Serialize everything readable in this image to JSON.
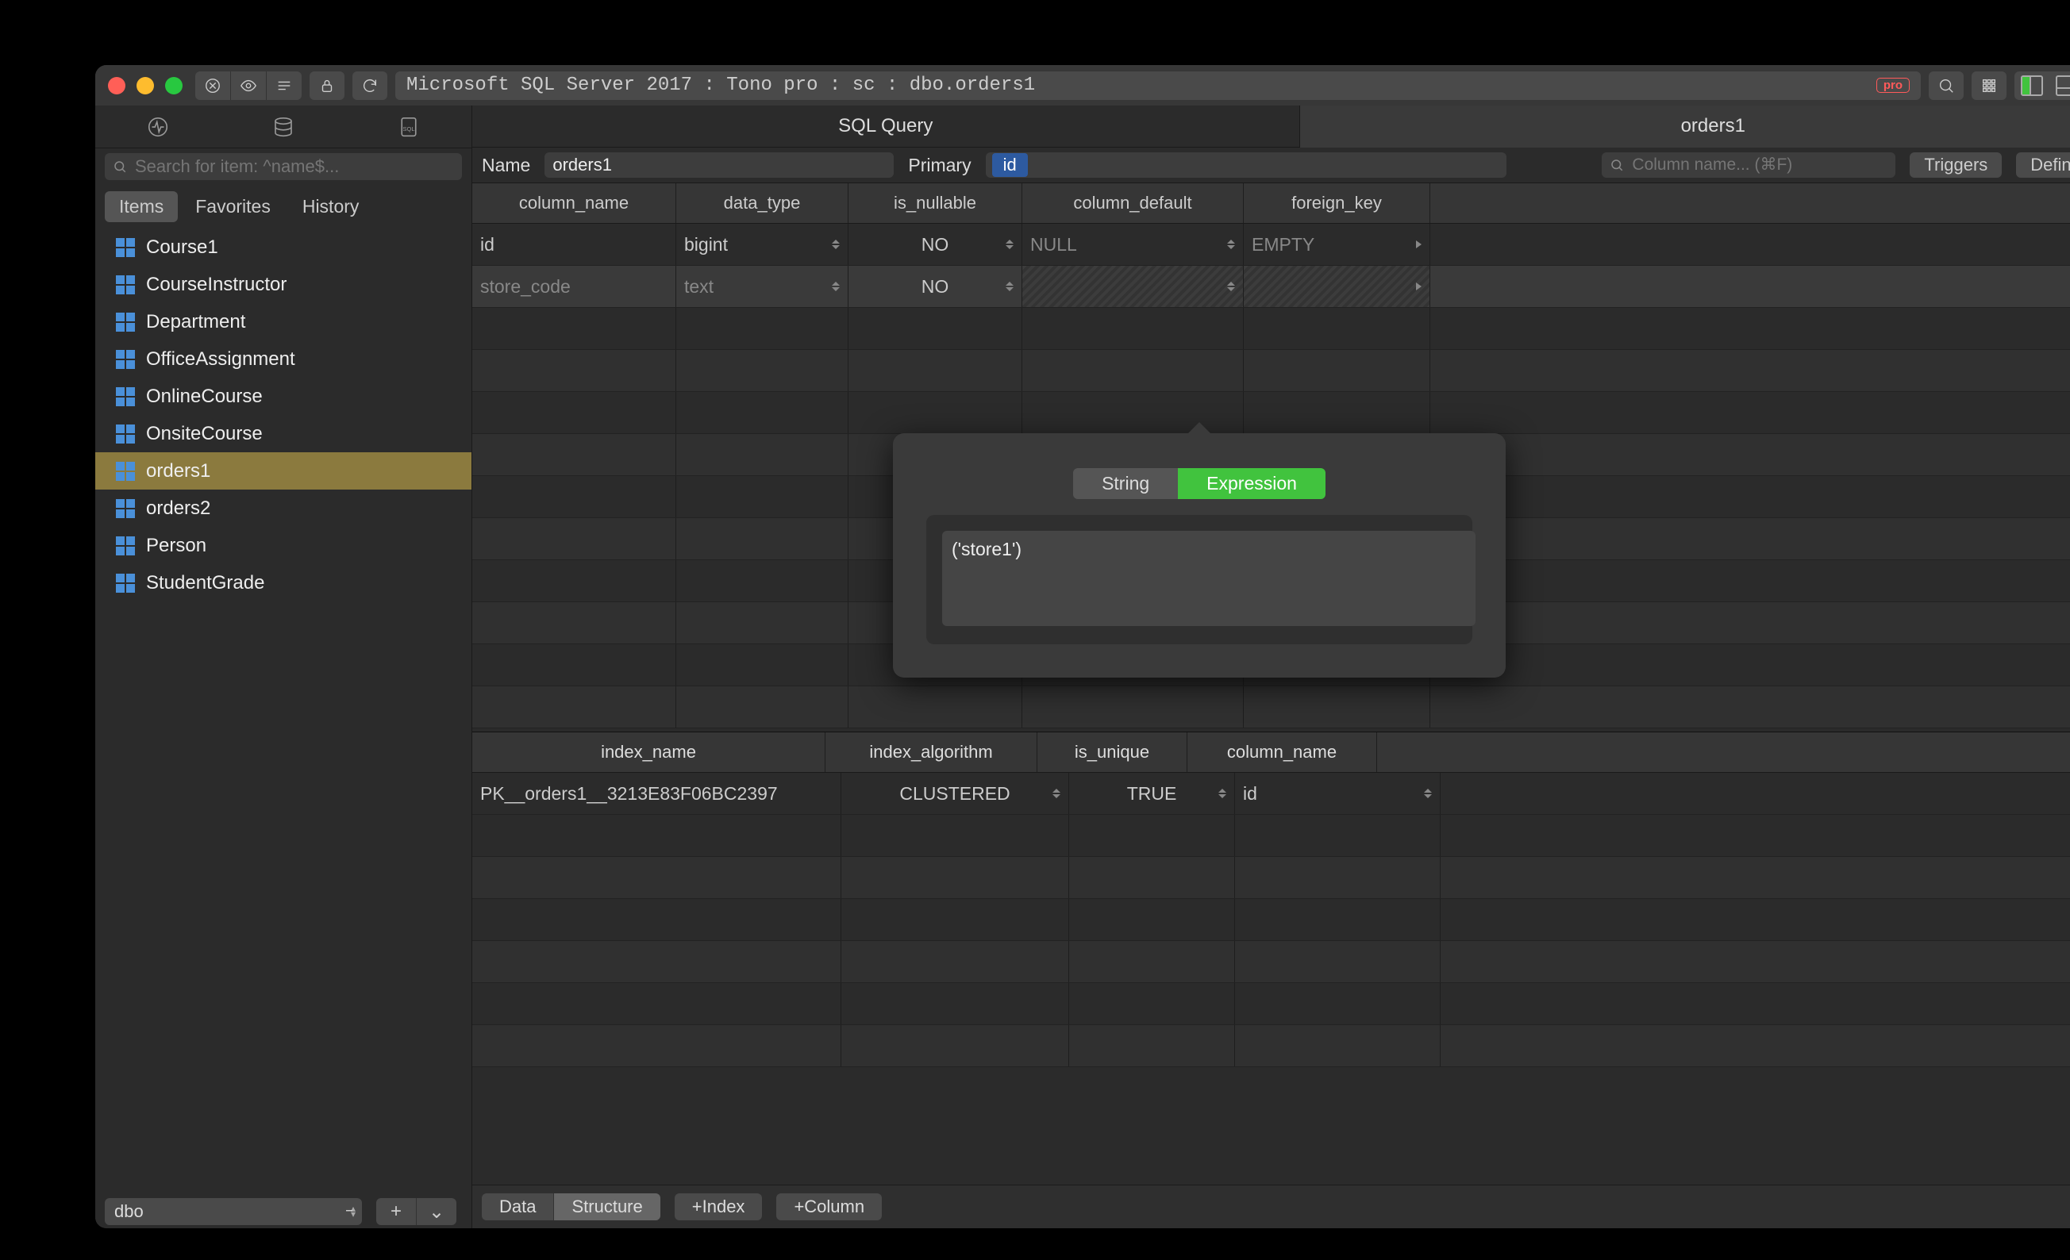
{
  "titlebar": {
    "address": "Microsoft SQL Server 2017 : Tono pro : sc : dbo.orders1",
    "pro_badge": "pro"
  },
  "sidebar": {
    "search_placeholder": "Search for item: ^name$...",
    "tabs": [
      "Items",
      "Favorites",
      "History"
    ],
    "active_tab": 0,
    "items": [
      "Course1",
      "CourseInstructor",
      "Department",
      "OfficeAssignment",
      "OnlineCourse",
      "OnsiteCourse",
      "orders1",
      "orders2",
      "Person",
      "StudentGrade"
    ],
    "selected": "orders1",
    "schema": "dbo"
  },
  "main": {
    "tabs": [
      "SQL Query",
      "orders1"
    ],
    "active_tab": 1,
    "name_label": "Name",
    "name_value": "orders1",
    "primary_label": "Primary",
    "primary_token": "id",
    "col_search_placeholder": "Column name... (⌘F)",
    "triggers_btn": "Triggers",
    "definition_btn": "Definition",
    "col_headers": [
      "column_name",
      "data_type",
      "is_nullable",
      "column_default",
      "foreign_key"
    ],
    "columns": [
      {
        "name": "id",
        "type": "bigint",
        "nullable": "NO",
        "default": "NULL",
        "fk": "EMPTY",
        "dim_default": true,
        "dim_fk": true
      },
      {
        "name": "store_code",
        "type": "text",
        "nullable": "NO",
        "default": "",
        "fk": "",
        "locked": true,
        "hatch": true
      }
    ],
    "idx_headers": [
      "index_name",
      "index_algorithm",
      "is_unique",
      "column_name"
    ],
    "indexes": [
      {
        "name": "PK__orders1__3213E83F06BC2397",
        "alg": "CLUSTERED",
        "unique": "TRUE",
        "col": "id"
      }
    ],
    "footer": {
      "seg": [
        "Data",
        "Structure"
      ],
      "seg_active": 1,
      "index_btn": "Index",
      "column_btn": "Column"
    }
  },
  "popover": {
    "tabs": [
      "String",
      "Expression"
    ],
    "active": 1,
    "value": "('store1')"
  }
}
